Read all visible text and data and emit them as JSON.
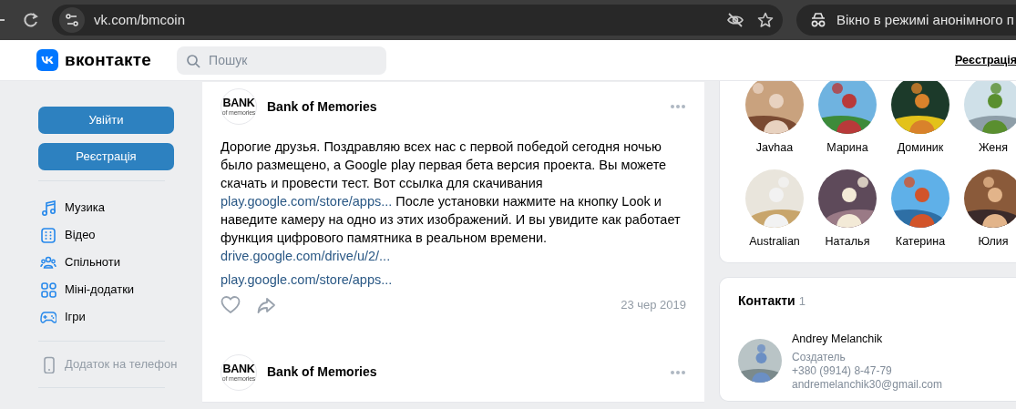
{
  "browser": {
    "url": "vk.com/bmcoin",
    "incognito_label": "Вікно в режимі анонімного п"
  },
  "header": {
    "logo_text": "вконтакте",
    "search": {
      "placeholder": "Пошук"
    },
    "register_link": "Реєстрація"
  },
  "sidebar": {
    "buttons": [
      {
        "label": "Увійти"
      },
      {
        "label": "Реєстрація"
      }
    ],
    "menu": [
      {
        "label": "Музика",
        "kind": "music"
      },
      {
        "label": "Відео",
        "kind": "video"
      },
      {
        "label": "Спільноти",
        "kind": "groups"
      },
      {
        "label": "Міні-додатки",
        "kind": "apps"
      },
      {
        "label": "Ігри",
        "kind": "games"
      }
    ],
    "app_link": {
      "label": "Додаток на телефон",
      "disabled": true
    }
  },
  "posts": [
    {
      "author": "Bank of Memories",
      "logo_text": "BANK",
      "logo_subtext": "of memories",
      "lines": [
        [
          {
            "kind": "text",
            "text": "Дорогие друзья. Поздравляю всех нас с первой победой сегодня ночью"
          }
        ],
        [
          {
            "kind": "text",
            "text": "было размещено, а Google play первая бета версия проекта. Вы можете"
          }
        ],
        [
          {
            "kind": "text",
            "text": "скачать и провести тест. Вот ссылка для скачивания"
          }
        ],
        [
          {
            "kind": "link",
            "text": "play.google.com/store/apps..."
          },
          {
            "kind": "text",
            "text": " После установки нажмите на кнопку Look и"
          }
        ],
        [
          {
            "kind": "text",
            "text": "наведите камеру на одно из этих изображений. И вы увидите как работает"
          }
        ],
        [
          {
            "kind": "text",
            "text": "функция цифрового памятника в реальном времени."
          }
        ],
        [
          {
            "kind": "link",
            "text": "drive.google.com/drive/u/2/..."
          }
        ]
      ],
      "attachment_link": "play.google.com/store/apps...",
      "liked": false,
      "date": "23 чер 2019"
    },
    {
      "author": "Bank of Memories",
      "logo_text": "BANK",
      "logo_subtext": "of memories"
    }
  ],
  "friends": [
    {
      "name": "Javhaa"
    },
    {
      "name": "Марина"
    },
    {
      "name": "Доминик"
    },
    {
      "name": "Женя"
    },
    {
      "name": "Australian"
    },
    {
      "name": "Наталья"
    },
    {
      "name": "Катерина"
    },
    {
      "name": "Юлия"
    }
  ],
  "contacts": {
    "title": "Контакти",
    "count": "1",
    "items": [
      {
        "name": "Andrey Melanchik",
        "role": "Создатель",
        "phone": "+380 (9914) 8-47-79",
        "email": "andremelanchik30@gmail.com"
      }
    ]
  }
}
